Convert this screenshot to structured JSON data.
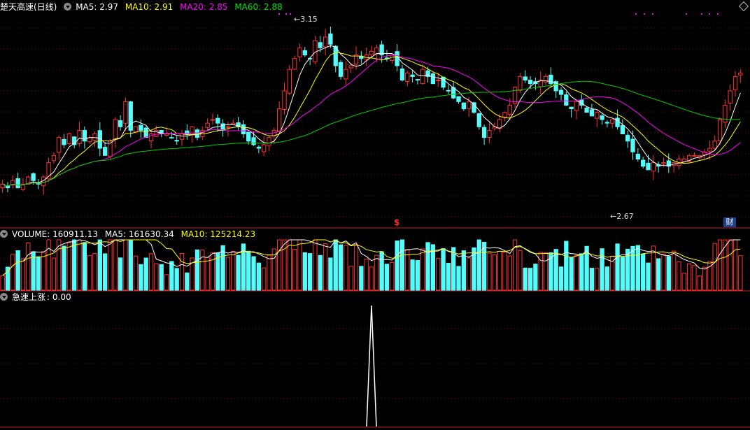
{
  "header": {
    "title": "楚天高速(日线)",
    "ma5": "MA5: 2.97",
    "ma10": "MA10: 2.91",
    "ma20": "MA20: 2.85",
    "ma60": "MA60: 2.88"
  },
  "volume_header": {
    "volume": "VOLUME: 160911.13",
    "ma5": "MA5: 161630.34",
    "ma10": "MA10: 125214.23"
  },
  "indicator_header": {
    "name": "急速上涨",
    "value": ": 0.00"
  },
  "annotations": {
    "high": "3.15",
    "low": "2.67",
    "cai_badge": "财",
    "dollar": "$"
  },
  "colors": {
    "up": "#ff3232",
    "down": "#54fcfc",
    "ma5": "#ffffff",
    "ma10": "#ffff00",
    "ma20": "#ff00ff",
    "ma60": "#00d000",
    "grid": "#8b0000",
    "frame": "#c81e1e"
  },
  "chart_data": {
    "type": "candlestick",
    "price_range": [
      2.6,
      3.2
    ],
    "indicator_spike_at_bar": 72,
    "closes": [
      2.72,
      2.71,
      2.73,
      2.71,
      2.72,
      2.74,
      2.73,
      2.72,
      2.74,
      2.78,
      2.8,
      2.85,
      2.83,
      2.86,
      2.83,
      2.87,
      2.84,
      2.85,
      2.86,
      2.82,
      2.8,
      2.84,
      2.9,
      2.88,
      2.95,
      2.87,
      2.88,
      2.87,
      2.85,
      2.86,
      2.87,
      2.86,
      2.86,
      2.85,
      2.84,
      2.86,
      2.86,
      2.88,
      2.85,
      2.87,
      2.89,
      2.9,
      2.89,
      2.87,
      2.88,
      2.89,
      2.88,
      2.86,
      2.84,
      2.83,
      2.82,
      2.83,
      2.85,
      2.87,
      2.93,
      2.98,
      3.04,
      3.07,
      3.1,
      3.08,
      3.07,
      3.12,
      3.1,
      3.13,
      3.11,
      3.05,
      3.02,
      3.04,
      3.05,
      3.08,
      3.07,
      3.08,
      3.09,
      3.1,
      3.08,
      3.07,
      3.08,
      3.05,
      3.01,
      3.03,
      3.02,
      3.01,
      3.04,
      3.02,
      3.0,
      3.01,
      2.99,
      2.98,
      2.96,
      2.95,
      2.93,
      2.95,
      2.92,
      2.88,
      2.85,
      2.87,
      2.88,
      2.9,
      2.92,
      2.94,
      2.99,
      3.02,
      3.01,
      3.0,
      3.0,
      3.01,
      3.02,
      3.0,
      2.98,
      2.97,
      2.94,
      2.93,
      2.95,
      2.94,
      2.92,
      2.91,
      2.92,
      2.9,
      2.89,
      2.9,
      2.88,
      2.86,
      2.84,
      2.81,
      2.79,
      2.77,
      2.76,
      2.78,
      2.77,
      2.78,
      2.77,
      2.78,
      2.79,
      2.79,
      2.8,
      2.8,
      2.8,
      2.81,
      2.82,
      2.84,
      2.9,
      2.94,
      2.98,
      3.02,
      3.03
    ]
  }
}
